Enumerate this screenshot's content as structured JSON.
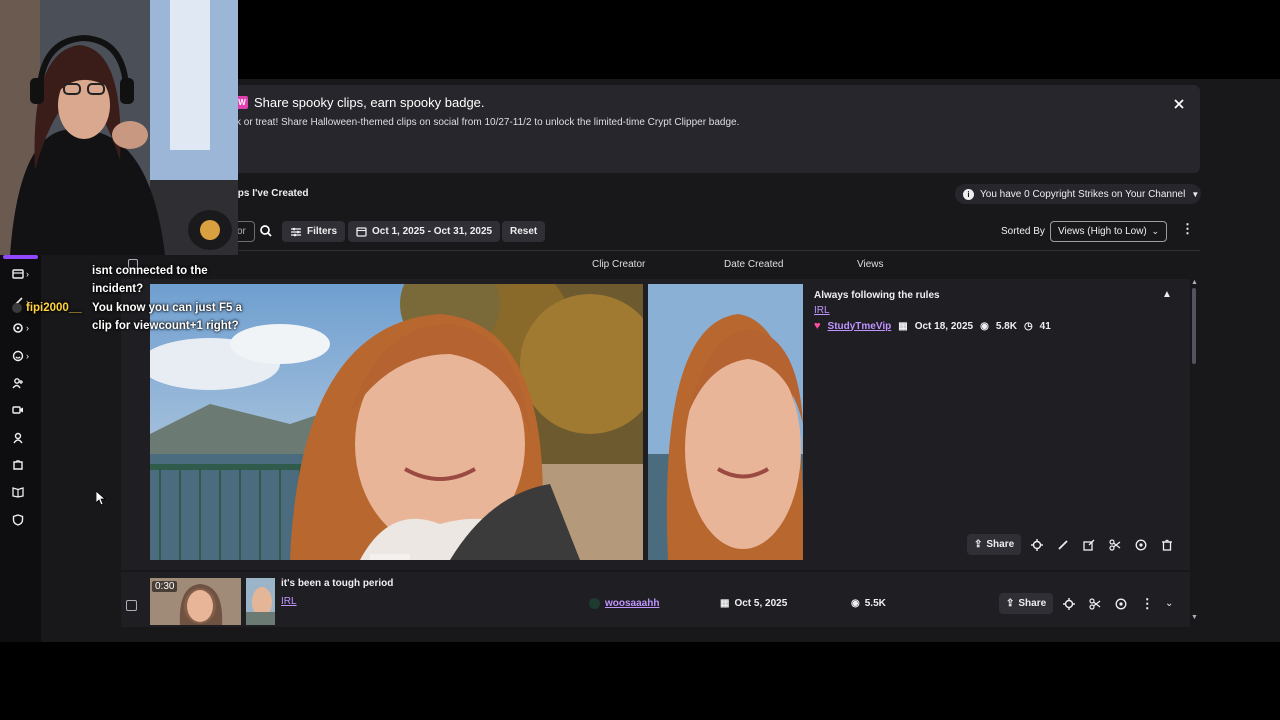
{
  "banner": {
    "badge": "W",
    "title": "Share spooky clips, earn spooky badge.",
    "subtitle": "k or treat! Share Halloween-themed clips on social from 10/27-11/2 to unlock the limited-time Crypt Clipper badge."
  },
  "section_title": "ips I've Created",
  "copyright_notice": "You have 0 Copyright Strikes on Your Channel",
  "toolbar": {
    "search_value": "or",
    "filters_label": "Filters",
    "date_range": "Oct 1, 2025 - Oct 31, 2025",
    "reset_label": "Reset",
    "sorted_by_label": "Sorted By",
    "sort_value": "Views (High to Low)"
  },
  "columns": [
    "Clip Creator",
    "Date Created",
    "Views"
  ],
  "expanded_clip": {
    "title": "Always following the rules",
    "category": "IRL",
    "creator": "StudyTmeVip",
    "date": "Oct 18, 2025",
    "views": "5.8K",
    "duration_partial": "41",
    "share_label": "Share"
  },
  "clips": [
    {
      "duration": "0:30",
      "title": "it's been a tough period",
      "category": "IRL",
      "creator": "woosaaahh",
      "date": "Oct 5, 2025",
      "views": "5.5K",
      "share_label": "Share"
    }
  ],
  "chat": {
    "line1": "isnt connected to the",
    "line2": "incident?",
    "user": "fipi2000__",
    "line3": "You know you can just F5 a",
    "line4": "clip for viewcount+1 right?"
  },
  "colors": {
    "accent": "#9147ff",
    "link": "#bf94ff",
    "background": "#18181b"
  }
}
